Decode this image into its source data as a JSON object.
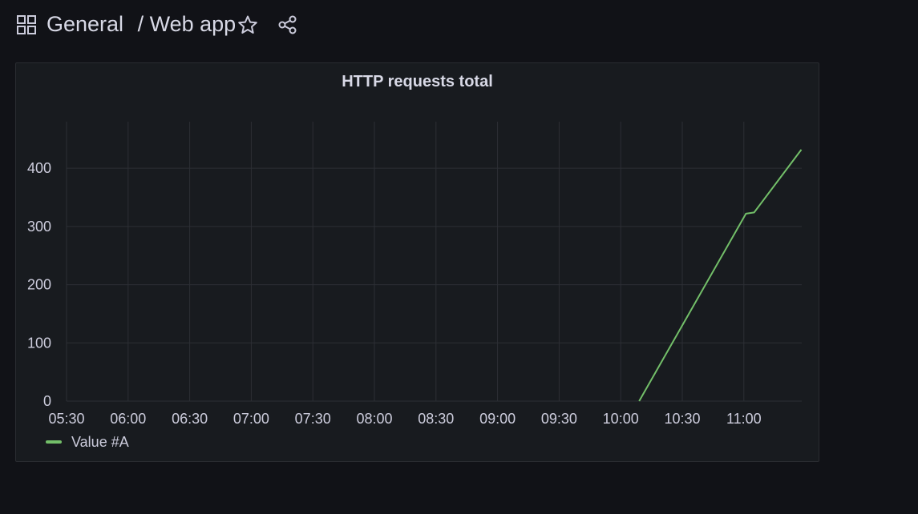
{
  "header": {
    "folder": "General",
    "separator": "/",
    "dashboard": "Web app",
    "icons": [
      "apps-icon",
      "star-icon",
      "share-icon"
    ]
  },
  "panel": {
    "title": "HTTP requests total"
  },
  "colors": {
    "background": "#111217",
    "panel": "#181b1f",
    "series": "#73bf69",
    "grid": "#2c2f35"
  },
  "chart_data": {
    "type": "line",
    "title": "HTTP requests total",
    "xlabel": "",
    "ylabel": "",
    "x_ticks": [
      "05:30",
      "06:00",
      "06:30",
      "07:00",
      "07:30",
      "08:00",
      "08:30",
      "09:00",
      "09:30",
      "10:00",
      "10:30",
      "11:00"
    ],
    "y_ticks": [
      0,
      100,
      200,
      300,
      400
    ],
    "xlim": [
      "05:30",
      "11:28"
    ],
    "ylim": [
      0,
      480
    ],
    "grid": true,
    "legend_placement": "bottom-left",
    "series": [
      {
        "name": "Value #A",
        "color": "#73bf69",
        "points": [
          {
            "x": "10:09",
            "y": 0
          },
          {
            "x": "11:01",
            "y": 322
          },
          {
            "x": "11:05",
            "y": 324
          },
          {
            "x": "11:28",
            "y": 432
          }
        ]
      }
    ]
  }
}
